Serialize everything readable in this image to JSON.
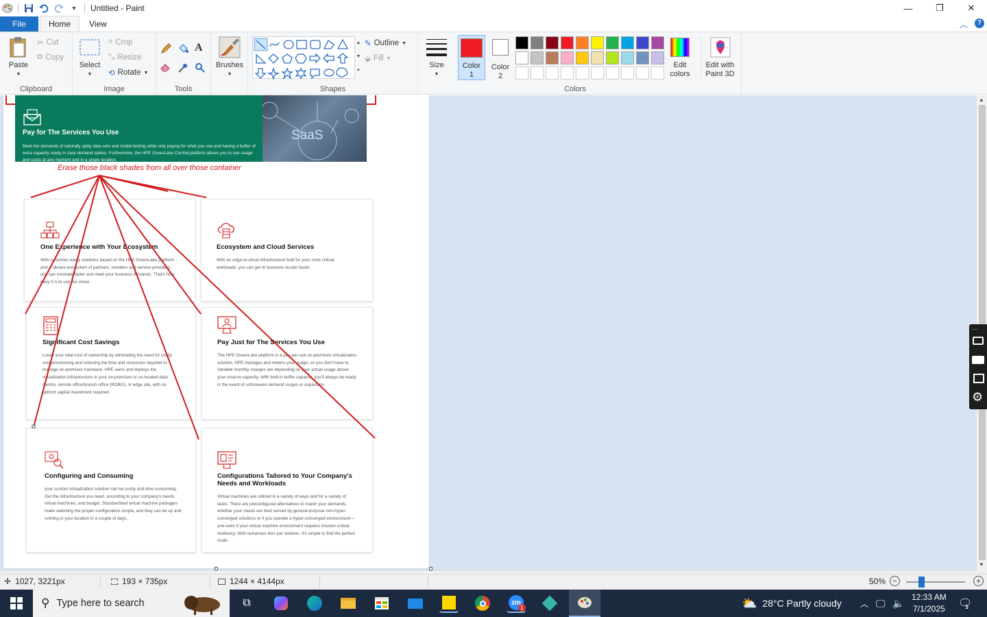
{
  "window": {
    "title": "Untitled - Paint",
    "controls": [
      "minimize-icon",
      "restore-icon",
      "close-icon"
    ]
  },
  "tabs": [
    {
      "label": "File",
      "active": false
    },
    {
      "label": "Home",
      "active": true
    },
    {
      "label": "View",
      "active": false
    }
  ],
  "ribbon": {
    "clipboard": {
      "paste": "Paste",
      "cut": "Cut",
      "copy": "Copy",
      "group": "Clipboard"
    },
    "image": {
      "select": "Select",
      "crop": "Crop",
      "resize": "Resize",
      "rotate": "Rotate",
      "group": "Image"
    },
    "tools": {
      "group": "Tools"
    },
    "brushes": {
      "label": "Brushes"
    },
    "shapes": {
      "outline": "Outline",
      "fill": "Fill",
      "group": "Shapes"
    },
    "size": {
      "label": "Size"
    },
    "colors": {
      "color1": "Color 1",
      "color2": "Color 2",
      "edit_colors": "Edit colors",
      "edit_paint3d": "Edit with Paint 3D",
      "group": "Colors",
      "color1_value": "#ed1c24",
      "color2_value": "#ffffff",
      "palette_row1": [
        "#000000",
        "#7f7f7f",
        "#880015",
        "#ed1c24",
        "#ff7f27",
        "#fff200",
        "#22b14c",
        "#00a2e8",
        "#3f48cc",
        "#a349a4"
      ],
      "palette_row2": [
        "#ffffff",
        "#c3c3c3",
        "#b97a57",
        "#ffaec9",
        "#ffc90e",
        "#efe4b0",
        "#b5e61d",
        "#99d9ea",
        "#7092be",
        "#c8bfe7"
      ],
      "palette_row3": [
        "#ffffff",
        "#ffffff",
        "#ffffff",
        "#ffffff",
        "#ffffff",
        "#ffffff",
        "#ffffff",
        "#ffffff",
        "#ffffff",
        "#ffffff"
      ]
    }
  },
  "canvas": {
    "banner": {
      "title": "Pay for The Services You Use",
      "text": "Meet the demands of naturally spiky data sets and model testing while only paying for what you use and having a buffer of extra capacity ready in case demand spikes. Furthermore, the HPE GreenLake Central platform allows you to see usage and costs at any moment and in a single location.",
      "image_label": "SaaS"
    },
    "annotation": "Erase those black shades from all over those container",
    "cards": [
      {
        "title": "One Experience with Your Ecosystem",
        "text": "With customer-ready solutions based on the HPE GreenLake platform and a vibrant ecosystem of partners, resellers and service providers, you can innovate faster and meet your business demands. That's how easy it is to use the cloud."
      },
      {
        "title": "Ecosystem and Cloud Services",
        "text": "With an edge-to-cloud infrastructure built for your most critical workloads, you can get to business results faster."
      },
      {
        "title": "Significant Cost Savings",
        "text": "Lower your total cost of ownership by eliminating the need for costly overprovisioning and reducing the time and resources required to manage on-premises hardware. HPE owns and deploys the virtualization infrastructure in your on-premises or co-located data Centre, remote office/branch office (ROBO), or edge site, with no upfront capital investment required."
      },
      {
        "title": "Pay Just for The Services You Use",
        "text": "The HPE GreenLake platform is a pay-per-use on-premises virtualization solution. HPE manages and meters your usage, so you don't have to. Variable monthly charges are depending on your actual usage above your reserve capacity. With built-in buffer capacity, you'll always be ready in the event of unforeseen demand surges or expansion."
      },
      {
        "title": "Configuring and Consuming",
        "text": "your custom virtualization solution can be costly and time-consuming. Get the infrastructure you need, according to your company's needs, virtual machines, and budget. Standardized virtual machine packages make selecting the proper configuration simple, and they can be up and running in your location in a couple of days."
      },
      {
        "title": "Configurations Tailored to Your Company's Needs and Workloads",
        "text": "Virtual machines are utilized in a variety of ways and for a variety of tasks. There are preconfigured alternatives to match your demands, whether your needs are best served by general-purpose non-hyper-converged solutions or if you operate a hyper-converged environment—and even if your virtual machine environment requires mission-critical resiliency. With numerous tiers per solution, it's simple to find the perfect scale."
      }
    ]
  },
  "statusbar": {
    "cursor": "1027, 3221px",
    "selection": "193 × 735px",
    "size": "1244 × 4144px",
    "zoom": "50%"
  },
  "taskbar": {
    "search_placeholder": "Type here to search",
    "weather": "28°C  Partly cloudy",
    "time": "12:33 AM",
    "date": "7/1/2025",
    "notif_count": "1"
  }
}
